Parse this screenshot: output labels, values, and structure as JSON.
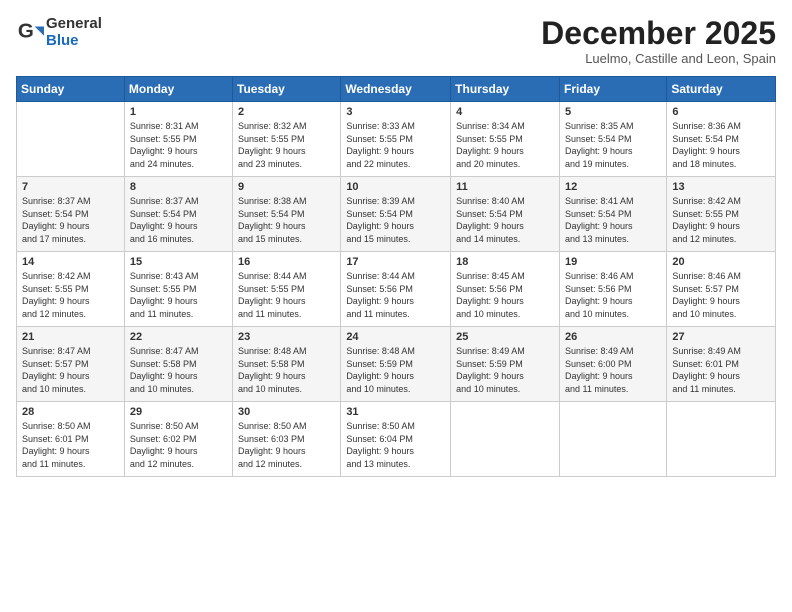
{
  "logo": {
    "general": "General",
    "blue": "Blue"
  },
  "title": {
    "month": "December 2025",
    "location": "Luelmo, Castille and Leon, Spain"
  },
  "weekdays": [
    "Sunday",
    "Monday",
    "Tuesday",
    "Wednesday",
    "Thursday",
    "Friday",
    "Saturday"
  ],
  "weeks": [
    [
      {
        "day": "",
        "info": ""
      },
      {
        "day": "1",
        "info": "Sunrise: 8:31 AM\nSunset: 5:55 PM\nDaylight: 9 hours\nand 24 minutes."
      },
      {
        "day": "2",
        "info": "Sunrise: 8:32 AM\nSunset: 5:55 PM\nDaylight: 9 hours\nand 23 minutes."
      },
      {
        "day": "3",
        "info": "Sunrise: 8:33 AM\nSunset: 5:55 PM\nDaylight: 9 hours\nand 22 minutes."
      },
      {
        "day": "4",
        "info": "Sunrise: 8:34 AM\nSunset: 5:55 PM\nDaylight: 9 hours\nand 20 minutes."
      },
      {
        "day": "5",
        "info": "Sunrise: 8:35 AM\nSunset: 5:54 PM\nDaylight: 9 hours\nand 19 minutes."
      },
      {
        "day": "6",
        "info": "Sunrise: 8:36 AM\nSunset: 5:54 PM\nDaylight: 9 hours\nand 18 minutes."
      }
    ],
    [
      {
        "day": "7",
        "info": "Sunrise: 8:37 AM\nSunset: 5:54 PM\nDaylight: 9 hours\nand 17 minutes."
      },
      {
        "day": "8",
        "info": "Sunrise: 8:37 AM\nSunset: 5:54 PM\nDaylight: 9 hours\nand 16 minutes."
      },
      {
        "day": "9",
        "info": "Sunrise: 8:38 AM\nSunset: 5:54 PM\nDaylight: 9 hours\nand 15 minutes."
      },
      {
        "day": "10",
        "info": "Sunrise: 8:39 AM\nSunset: 5:54 PM\nDaylight: 9 hours\nand 15 minutes."
      },
      {
        "day": "11",
        "info": "Sunrise: 8:40 AM\nSunset: 5:54 PM\nDaylight: 9 hours\nand 14 minutes."
      },
      {
        "day": "12",
        "info": "Sunrise: 8:41 AM\nSunset: 5:54 PM\nDaylight: 9 hours\nand 13 minutes."
      },
      {
        "day": "13",
        "info": "Sunrise: 8:42 AM\nSunset: 5:55 PM\nDaylight: 9 hours\nand 12 minutes."
      }
    ],
    [
      {
        "day": "14",
        "info": "Sunrise: 8:42 AM\nSunset: 5:55 PM\nDaylight: 9 hours\nand 12 minutes."
      },
      {
        "day": "15",
        "info": "Sunrise: 8:43 AM\nSunset: 5:55 PM\nDaylight: 9 hours\nand 11 minutes."
      },
      {
        "day": "16",
        "info": "Sunrise: 8:44 AM\nSunset: 5:55 PM\nDaylight: 9 hours\nand 11 minutes."
      },
      {
        "day": "17",
        "info": "Sunrise: 8:44 AM\nSunset: 5:56 PM\nDaylight: 9 hours\nand 11 minutes."
      },
      {
        "day": "18",
        "info": "Sunrise: 8:45 AM\nSunset: 5:56 PM\nDaylight: 9 hours\nand 10 minutes."
      },
      {
        "day": "19",
        "info": "Sunrise: 8:46 AM\nSunset: 5:56 PM\nDaylight: 9 hours\nand 10 minutes."
      },
      {
        "day": "20",
        "info": "Sunrise: 8:46 AM\nSunset: 5:57 PM\nDaylight: 9 hours\nand 10 minutes."
      }
    ],
    [
      {
        "day": "21",
        "info": "Sunrise: 8:47 AM\nSunset: 5:57 PM\nDaylight: 9 hours\nand 10 minutes."
      },
      {
        "day": "22",
        "info": "Sunrise: 8:47 AM\nSunset: 5:58 PM\nDaylight: 9 hours\nand 10 minutes."
      },
      {
        "day": "23",
        "info": "Sunrise: 8:48 AM\nSunset: 5:58 PM\nDaylight: 9 hours\nand 10 minutes."
      },
      {
        "day": "24",
        "info": "Sunrise: 8:48 AM\nSunset: 5:59 PM\nDaylight: 9 hours\nand 10 minutes."
      },
      {
        "day": "25",
        "info": "Sunrise: 8:49 AM\nSunset: 5:59 PM\nDaylight: 9 hours\nand 10 minutes."
      },
      {
        "day": "26",
        "info": "Sunrise: 8:49 AM\nSunset: 6:00 PM\nDaylight: 9 hours\nand 11 minutes."
      },
      {
        "day": "27",
        "info": "Sunrise: 8:49 AM\nSunset: 6:01 PM\nDaylight: 9 hours\nand 11 minutes."
      }
    ],
    [
      {
        "day": "28",
        "info": "Sunrise: 8:50 AM\nSunset: 6:01 PM\nDaylight: 9 hours\nand 11 minutes."
      },
      {
        "day": "29",
        "info": "Sunrise: 8:50 AM\nSunset: 6:02 PM\nDaylight: 9 hours\nand 12 minutes."
      },
      {
        "day": "30",
        "info": "Sunrise: 8:50 AM\nSunset: 6:03 PM\nDaylight: 9 hours\nand 12 minutes."
      },
      {
        "day": "31",
        "info": "Sunrise: 8:50 AM\nSunset: 6:04 PM\nDaylight: 9 hours\nand 13 minutes."
      },
      {
        "day": "",
        "info": ""
      },
      {
        "day": "",
        "info": ""
      },
      {
        "day": "",
        "info": ""
      }
    ]
  ]
}
